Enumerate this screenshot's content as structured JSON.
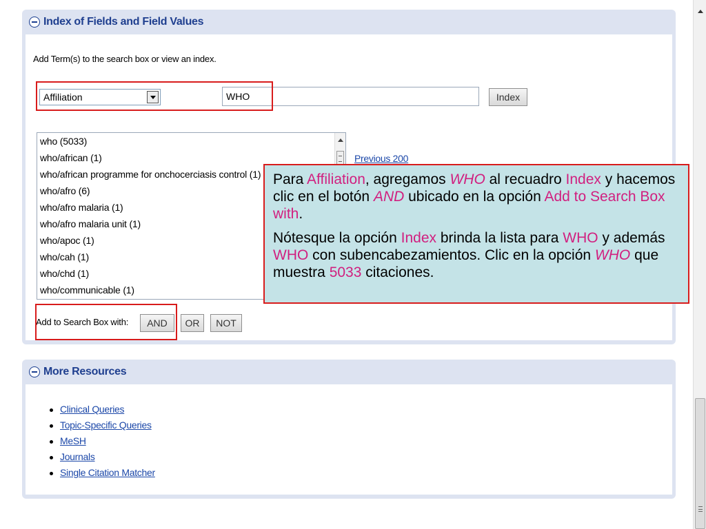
{
  "index_panel": {
    "title": "Index of Fields and Field Values",
    "intro": "Add Term(s) to the search box or view an index.",
    "field_select": {
      "selected": "Affiliation"
    },
    "term_input": {
      "value": "WHO"
    },
    "index_button": "Index",
    "list_items": [
      "who (5033)",
      "who/african (1)",
      "who/african programme for onchocerciasis control (1)",
      "who/afro (6)",
      "who/afro malaria (1)",
      "who/afro malaria unit (1)",
      "who/apoc (1)",
      "who/cah (1)",
      "who/chd (1)",
      "who/communicable (1)"
    ],
    "previous_link": "Previous 200",
    "add_to_label": "Add to Search Box with:",
    "and_button": "AND",
    "or_button": "OR",
    "not_button": "NOT"
  },
  "resources_panel": {
    "title": "More Resources",
    "links": [
      "Clinical Queries",
      "Topic-Specific Queries",
      "MeSH",
      "Journals",
      "Single Citation Matcher"
    ]
  },
  "callout": {
    "p1": {
      "t1": "Para ",
      "h1": "Affiliation",
      "t2": ", agregamos ",
      "h2": "WHO",
      "t3": " al recuadro ",
      "h3": "Index",
      "t4": " y hacemos clic en el botón ",
      "h4": "AND",
      "t5": " ubicado en la opción ",
      "h5": "Add to Search Box with",
      "t6": "."
    },
    "p2": {
      "t1": "Nótesque la opción ",
      "h1": "Index",
      "t2": " brinda la lista para ",
      "h2": "WHO",
      "t3": " y además ",
      "h3": "WHO",
      "t4": " con subencabezamientos. Clic en la opción ",
      "h4": "WHO",
      "t5": " que muestra ",
      "h5": "5033",
      "t6": " citaciones."
    }
  },
  "colors": {
    "panel_bg": "#dde3f1",
    "title": "#1f3f8f",
    "link": "#1b47a8",
    "highlight_box": "#d81b1b",
    "callout_bg": "#c4e3e7",
    "callout_highlight": "#d11f7f"
  }
}
